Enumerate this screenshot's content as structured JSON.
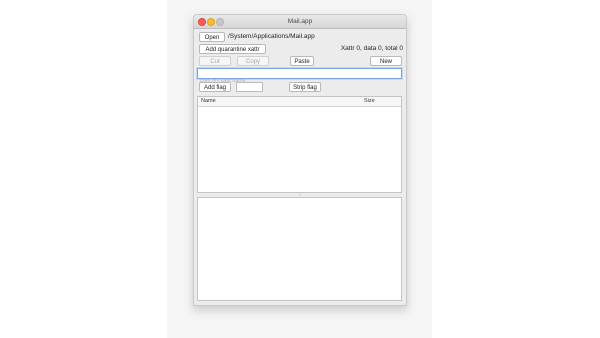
{
  "window": {
    "title": "Mail.app"
  },
  "toolbar": {
    "open_label": "Open",
    "path": "/System/Applications/Mail.app",
    "add_quarantine_label": "Add quarantine xattr",
    "xattr_info": "Xattr 0, data 0, total 0",
    "cut_label": "Cut",
    "copy_label": "Copy",
    "paste_label": "Paste",
    "new_label": "New",
    "search_placeholder": "com.my.xattr.name",
    "add_flag_label": "Add flag",
    "flag_value": "",
    "strip_flag_label": "Strip flag"
  },
  "list": {
    "columns": [
      "Name",
      "Size"
    ]
  }
}
